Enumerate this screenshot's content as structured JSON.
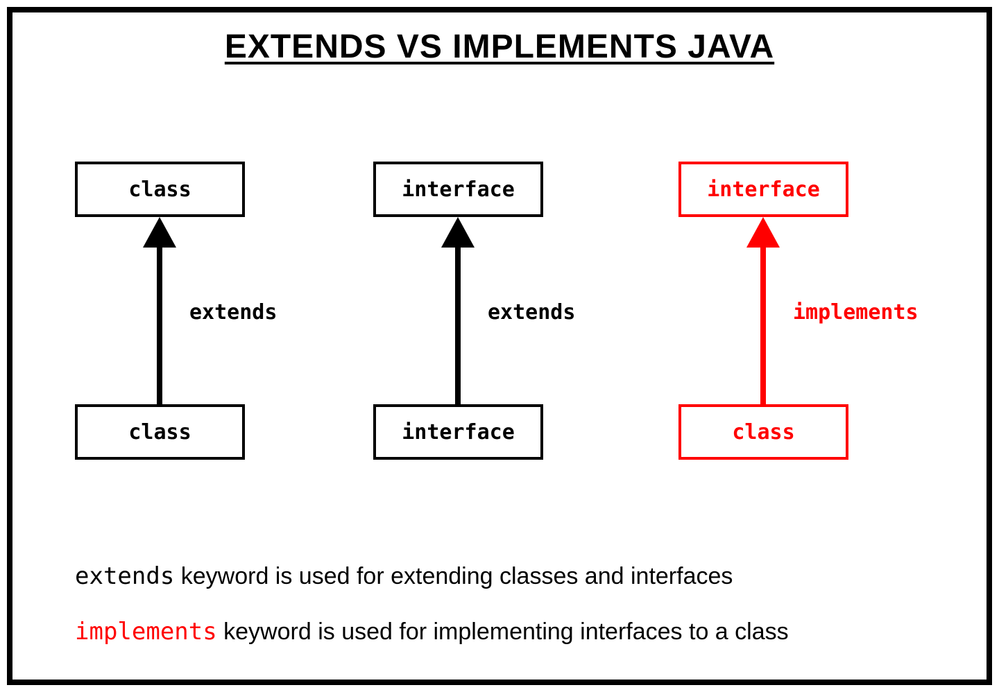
{
  "title": "EXTENDS VS IMPLEMENTS JAVA",
  "columns": [
    {
      "top": "class",
      "bottom": "class",
      "relation": "extends",
      "color": "black"
    },
    {
      "top": "interface",
      "bottom": "interface",
      "relation": "extends",
      "color": "black"
    },
    {
      "top": "interface",
      "bottom": "class",
      "relation": "implements",
      "color": "red"
    }
  ],
  "footer": {
    "line1": {
      "keyword": "extends",
      "text": " keyword is used for extending classes and interfaces"
    },
    "line2": {
      "keyword": "implements",
      "text": " keyword is used for implementing interfaces to a class"
    }
  }
}
